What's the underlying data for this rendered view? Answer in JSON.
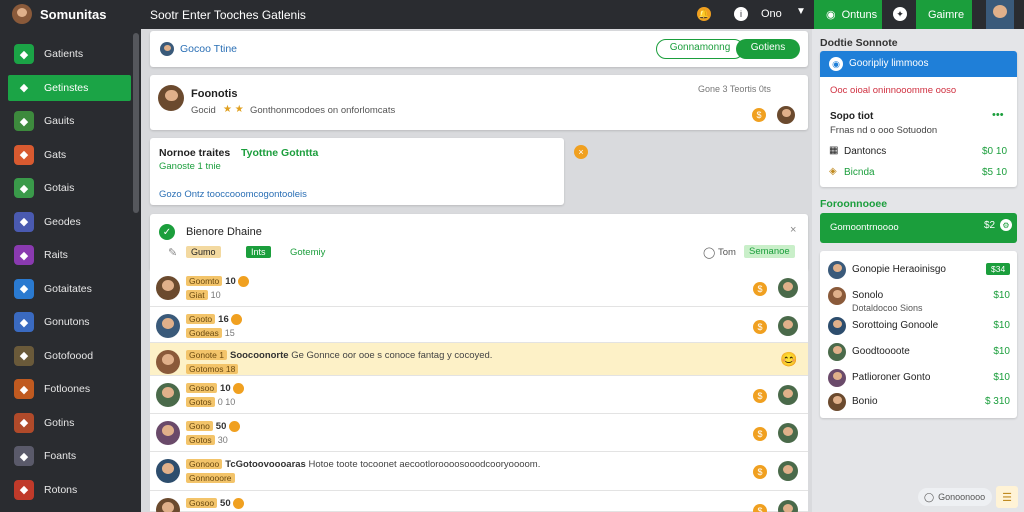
{
  "topbar": {
    "app_title": "Somunitas",
    "center_title": "Sootr Enter Tooches Gatlenis",
    "user_name": "Ono",
    "tab1_label": "Ontuns",
    "tab2_label": "Gaimre"
  },
  "sidebar": {
    "items": [
      {
        "label": "Gatients",
        "icon": "box-icon",
        "color": "#1ba446"
      },
      {
        "label": "Getinstes",
        "icon": "chat-icon",
        "color": "#1ba446"
      },
      {
        "label": "Gauits",
        "icon": "globe-icon",
        "color": "#3d8a3d"
      },
      {
        "label": "Gats",
        "icon": "image-icon",
        "color": "#d85a30"
      },
      {
        "label": "Gotais",
        "icon": "group-icon",
        "color": "#3a9a4a"
      },
      {
        "label": "Geodes",
        "icon": "cube-icon",
        "color": "#4a5ab0"
      },
      {
        "label": "Raits",
        "icon": "puzzle-icon",
        "color": "#8a3ab0"
      },
      {
        "label": "Gotaitates",
        "icon": "chart-icon",
        "color": "#2a7ad0"
      },
      {
        "label": "Gonutons",
        "icon": "compass-icon",
        "color": "#3a6ac0"
      },
      {
        "label": "Gotofoood",
        "icon": "folder-icon",
        "color": "#6a5a3a"
      },
      {
        "label": "Fotloones",
        "icon": "star-icon",
        "color": "#c05a20"
      },
      {
        "label": "Gotins",
        "icon": "user-icon",
        "color": "#b04a2a"
      },
      {
        "label": "Foants",
        "icon": "shield-icon",
        "color": "#5a5a6a"
      },
      {
        "label": "Rotons",
        "icon": "flame-icon",
        "color": "#c03a2a"
      }
    ]
  },
  "main": {
    "header": {
      "label": "Gocoo Ttine",
      "btn_outline": "Gonnamonng",
      "btn_green": "Gotiens"
    },
    "profile": {
      "name": "Foonotis",
      "meta": "Gocid",
      "desc": "Gonthonmcodoes on onforlomcats",
      "right_meta": "Gone 3 Teortis 0ts"
    },
    "notice": {
      "title": "Nornoe traites",
      "title_green": "Tyottne Gotntta",
      "sub": "Ganoste 1 tnie",
      "link": "Gozo Ontz tooccooomcogontooleis"
    },
    "section": {
      "title": "Bienore Dhaine",
      "tag1": "Gumo",
      "tag2": "Ints",
      "link": "Gotemiy",
      "right_text": "Tom",
      "right_badge": "Semanoe"
    },
    "rows": [
      {
        "name": "Goomto",
        "num": "10",
        "sub": "Giat",
        "sub2": "10"
      },
      {
        "name": "Gooto",
        "num": "16",
        "sub": "Godeas",
        "sub2": "15"
      },
      {
        "name": "Gonote 1",
        "num": "Soocoonorte",
        "sub": "Gotomos 18",
        "desc": "Ge Gonnce oor ooe s conoce fantag y cocoyed.",
        "highlight": true
      },
      {
        "name": "Gosoo",
        "num": "10",
        "sub": "Gotos",
        "sub2": "0 10"
      },
      {
        "name": "Gono",
        "num": "50",
        "sub": "Gotos",
        "sub2": "30"
      },
      {
        "name": "Gonooo",
        "num": "TcGotoovoooaras",
        "sub": "Gonnooore",
        "desc": "Hotoe toote tocoonet aecootloroooosooodcooryoooom."
      },
      {
        "name": "Gosoo",
        "num": "50",
        "sub": "Gotos",
        "sub2": ""
      }
    ]
  },
  "right": {
    "header": "Dodtie Sonnote",
    "selected": "Gooripliy limmoos",
    "red_text": "Ooc oioal oninnooomme ooso",
    "item_title": "Sopo tiot",
    "item_sub": "Frnas nd o ooo Sotuodon",
    "stat1_label": "Dantoncs",
    "stat1_value": "$0 10",
    "stat2_label": "Bicnda",
    "stat2_value": "$5 10",
    "section_title": "Foroonnooee",
    "green_bar_text": "Gomoontrnoooo",
    "green_bar_value": "$2",
    "list": [
      {
        "name": "Gonopie Heraoinisgo",
        "value": "$34",
        "badge": true
      },
      {
        "name": "Sonolo",
        "sub": "Dotaldocoo Sions",
        "value": "$10"
      },
      {
        "name": "Sorottoing Gonoole",
        "value": "$10"
      },
      {
        "name": "Goodtoooote",
        "value": "$10"
      },
      {
        "name": "Patlioroner Gonto",
        "value": "$10"
      },
      {
        "name": "Bonio",
        "value": "$ 310"
      }
    ],
    "bottom_btn": "Gonoonooo"
  }
}
